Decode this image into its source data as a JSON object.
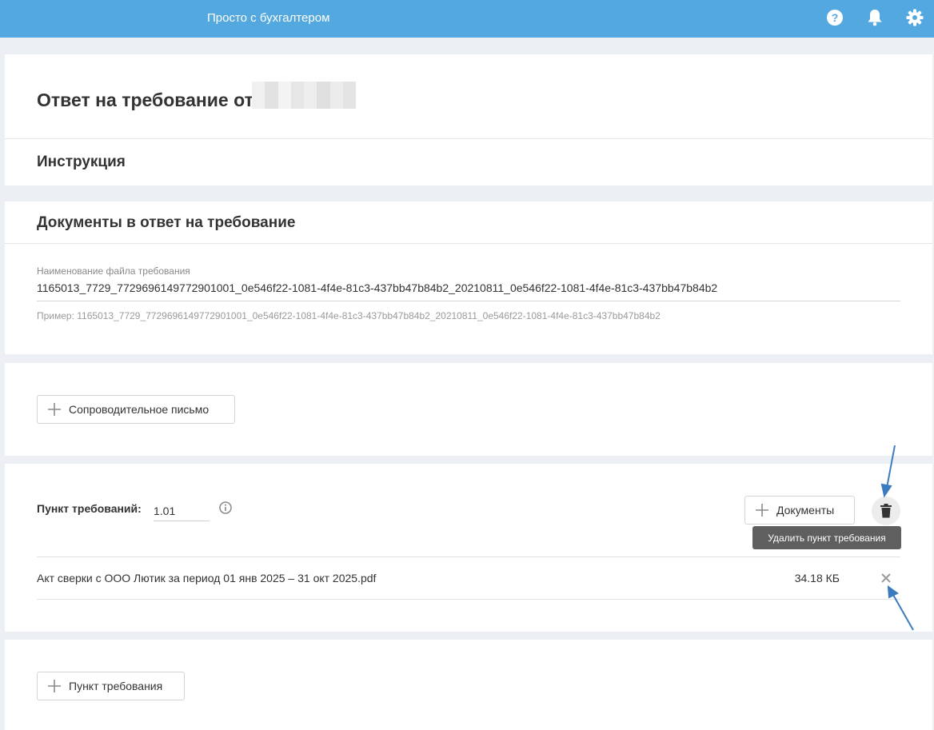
{
  "topbar": {
    "app_title": "Просто с бухгалтером",
    "icons": [
      "help-icon",
      "bell-icon",
      "gear-icon"
    ],
    "color": "#54a8e0"
  },
  "header": {
    "title": "Ответ на требование от",
    "instruction": "Инструкция"
  },
  "documents": {
    "title": "Документы в ответ на требование",
    "file_label": "Наименование файла требования",
    "file_value": "1165013_7729_7729696149772901001_0e546f22-1081-4f4e-81c3-437bb47b84b2_20210811_0e546f22-1081-4f4e-81c3-437bb47b84b2",
    "file_hint": "Пример: 1165013_7729_7729696149772901001_0e546f22-1081-4f4e-81c3-437bb47b84b2_20210811_0e546f22-1081-4f4e-81c3-437bb47b84b2"
  },
  "cover_letter": {
    "button_label": "Сопроводительное письмо"
  },
  "requirement_item": {
    "label": "Пункт требований:",
    "value": "1.01",
    "documents_button": "Документы",
    "tooltip": "Удалить пункт требования",
    "file": {
      "name": "Акт сверки с ООО Лютик за период 01 янв 2025 – 31 окт 2025.pdf",
      "size": "34.18 КБ"
    }
  },
  "add_item": {
    "button_label": "Пункт требования"
  },
  "colors": {
    "accent": "#54a8e0",
    "annotation_arrow": "#3a7bbf",
    "tooltip_bg": "#5f5f5f"
  }
}
